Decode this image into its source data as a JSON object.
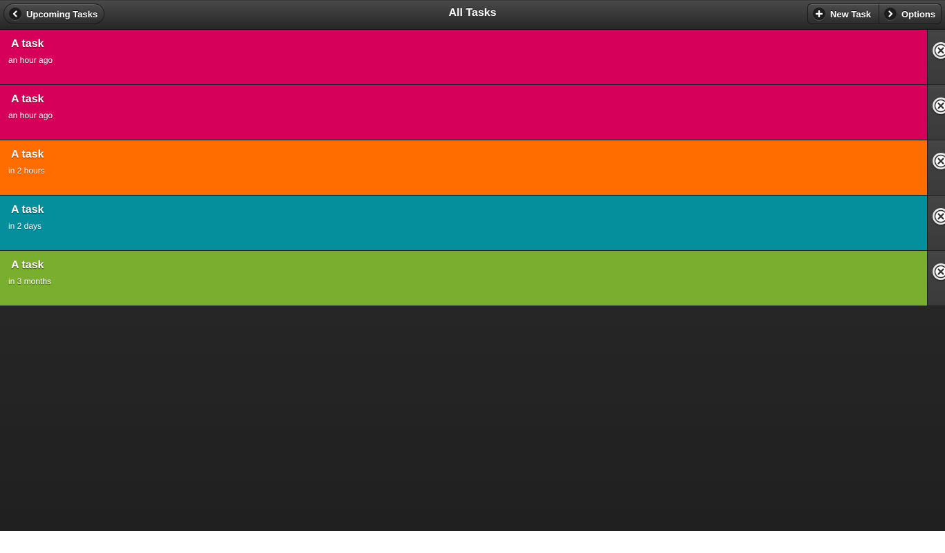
{
  "header": {
    "title": "All Tasks",
    "back_label": "Upcoming Tasks",
    "new_task_label": "New Task",
    "options_label": "Options"
  },
  "tasks": [
    {
      "title": "A task",
      "time": "an hour ago",
      "color": "#d6005b"
    },
    {
      "title": "A task",
      "time": "an hour ago",
      "color": "#d6005b"
    },
    {
      "title": "A task",
      "time": "in 2 hours",
      "color": "#ff6d00"
    },
    {
      "title": "A task",
      "time": "in 2 days",
      "color": "#058e9c"
    },
    {
      "title": "A task",
      "time": "in 3 months",
      "color": "#79ae2e"
    }
  ],
  "icons": {
    "back": "chevron-left-icon",
    "new_task": "plus-icon",
    "options": "chevron-right-icon",
    "delete": "close-circle-icon"
  }
}
